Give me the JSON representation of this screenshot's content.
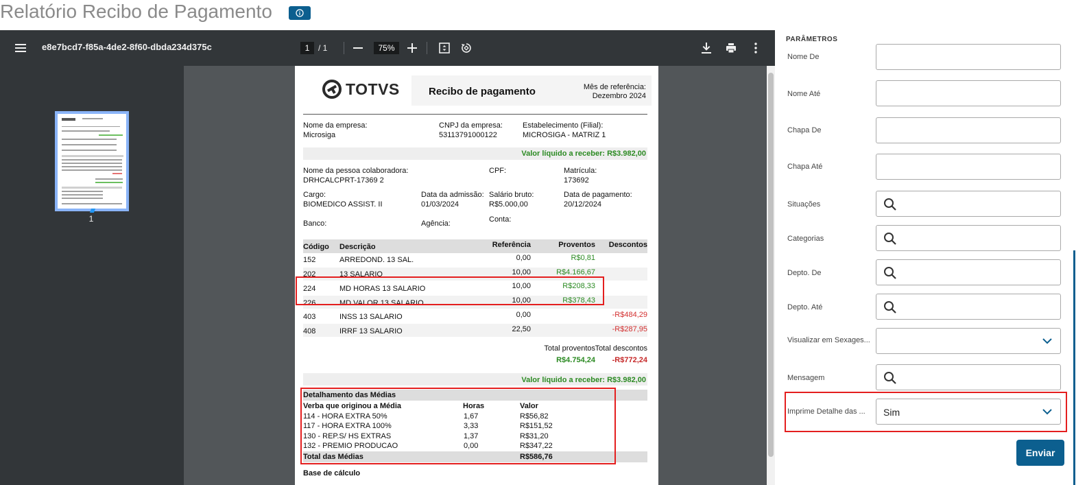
{
  "page": {
    "title": "Relatório Recibo de Pagamento"
  },
  "viewer": {
    "file_name": "e8e7bcd7-f85a-4de2-8f60-dbda234d375c",
    "current_page": "1",
    "page_total": "/  1",
    "zoom": "75%",
    "thumbnail_label": "1"
  },
  "doc": {
    "logo": "TOTVS",
    "title": "Recibo de pagamento",
    "ref_label": "Mês de referência:",
    "ref_value": "Dezembro 2024",
    "company_label": "Nome da empresa:",
    "company_value": "Microsiga",
    "cnpj_label": "CNPJ da empresa:",
    "cnpj_value": "53113791000122",
    "estab_label": "Estabelecimento (Filial):",
    "estab_value": "MICROSIGA - MATRIZ 1",
    "net_top": "Valor líquido a receber: R$3.982,00",
    "person_label": "Nome da pessoa colaboradora:",
    "person_value": "DRHCALCPRT-17369 2",
    "cpf_label": "CPF:",
    "matricula_label": "Matrícula:",
    "matricula_value": "173692",
    "cargo_label": "Cargo:",
    "cargo_value": "BIOMEDICO ASSIST. II",
    "admissao_label": "Data da admissão:",
    "admissao_value": "01/03/2024",
    "salario_label": "Salário bruto:",
    "salario_value": "R$5.000,00",
    "pagamento_label": "Data de pagamento:",
    "pagamento_value": "20/12/2024",
    "banco_label": "Banco:",
    "agencia_label": "Agência:",
    "conta_label": "Conta:",
    "table_headers": {
      "codigo": "Código",
      "descricao": "Descrição",
      "referencia": "Referência",
      "proventos": "Proventos",
      "descontos": "Descontos"
    },
    "rows": [
      {
        "codigo": "152",
        "descricao": "ARREDOND. 13 SAL.",
        "referencia": "0,00",
        "proventos": "R$0,81",
        "descontos": ""
      },
      {
        "codigo": "202",
        "descricao": "13 SALARIO",
        "referencia": "10,00",
        "proventos": "R$4.166,67",
        "descontos": ""
      },
      {
        "codigo": "224",
        "descricao": "MD HORAS 13 SALARIO",
        "referencia": "10,00",
        "proventos": "R$208,33",
        "descontos": ""
      },
      {
        "codigo": "226",
        "descricao": "MD VALOR 13 SALARIO",
        "referencia": "10,00",
        "proventos": "R$378,43",
        "descontos": ""
      },
      {
        "codigo": "403",
        "descricao": "INSS 13 SALARIO",
        "referencia": "0,00",
        "proventos": "",
        "descontos": "-R$484,29"
      },
      {
        "codigo": "408",
        "descricao": "IRRF 13 SALARIO",
        "referencia": "22,50",
        "proventos": "",
        "descontos": "-R$287,95"
      }
    ],
    "total_proventos_label": "Total proventos",
    "total_descontos_label": "Total descontos",
    "total_proventos_value": "R$4.754,24",
    "total_descontos_value": "-R$772,24",
    "net_bottom": "Valor líquido a receber:  R$3.982,00",
    "medias_title": "Detalhamento das Médias",
    "medias_headers": {
      "verba": "Verba que originou a Média",
      "horas": "Horas",
      "valor": "Valor"
    },
    "medias_rows": [
      {
        "verba": "114 - HORA EXTRA  50%",
        "horas": "1,67",
        "valor": "R$56,82"
      },
      {
        "verba": "117 - HORA EXTRA 100%",
        "horas": "3,33",
        "valor": "R$151,52"
      },
      {
        "verba": "130 - REP.S/ HS EXTRAS",
        "horas": "1,37",
        "valor": "R$31,20"
      },
      {
        "verba": "132 - PREMIO PRODUCAO",
        "horas": "0,00",
        "valor": "R$347,22"
      }
    ],
    "medias_total_label": "Total das Médias",
    "medias_total_value": "R$586,76",
    "base_calculo": "Base de cálculo"
  },
  "panel": {
    "title": "PARÂMETROS",
    "fields": [
      {
        "label": "Nome De",
        "type": "text",
        "value": ""
      },
      {
        "label": "Nome Até",
        "type": "text",
        "value": ""
      },
      {
        "label": "Chapa De",
        "type": "text",
        "value": ""
      },
      {
        "label": "Chapa Até",
        "type": "text",
        "value": ""
      },
      {
        "label": "Situações",
        "type": "lookup",
        "value": ""
      },
      {
        "label": "Categorias",
        "type": "lookup",
        "value": ""
      },
      {
        "label": "Depto. De",
        "type": "lookup",
        "value": ""
      },
      {
        "label": "Depto. Até",
        "type": "lookup",
        "value": ""
      },
      {
        "label": "Visualizar em Sexages...",
        "type": "select",
        "value": ""
      },
      {
        "label": "Mensagem",
        "type": "lookup",
        "value": ""
      },
      {
        "label": "Imprime Detalhe das ...",
        "type": "select",
        "value": "Sim"
      }
    ],
    "submit_label": "Enviar"
  },
  "colors": {
    "accent": "#0c5f8f",
    "highlight": "#e41e1e",
    "positive": "#2b8a22",
    "negative": "#d32f2f"
  }
}
